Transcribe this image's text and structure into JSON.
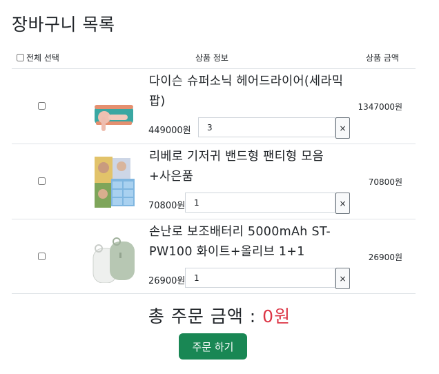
{
  "page": {
    "title": "장바구니 목록"
  },
  "table": {
    "select_all_label": "전체 선택",
    "col_info": "상품 정보",
    "col_price": "상품 금액"
  },
  "items": [
    {
      "name": "다이슨 슈퍼소닉 헤어드라이어(세라믹 팝)",
      "unit_price": "449000원",
      "quantity": "3",
      "remove_label": "×",
      "total": "1347000원"
    },
    {
      "name": "리베로 기저귀 밴드형 팬티형 모음 +사은품",
      "unit_price": "70800원",
      "quantity": "1",
      "remove_label": "×",
      "total": "70800원"
    },
    {
      "name": "손난로 보조배터리 5000mAh ST-PW100 화이트+올리브 1+1",
      "unit_price": "26900원",
      "quantity": "1",
      "remove_label": "×",
      "total": "26900원"
    }
  ],
  "summary": {
    "label": "총 주문 금액",
    "separator": ":",
    "amount": "0원",
    "amount_color": "#dc3545"
  },
  "order_button": {
    "label": "주문 하기",
    "color": "#198754"
  }
}
